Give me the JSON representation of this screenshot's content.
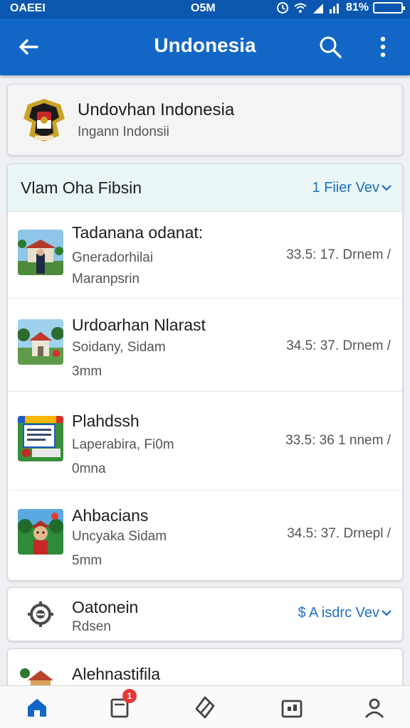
{
  "status_bar": {
    "left": "OAEEI",
    "center": "O5M",
    "battery": "81%"
  },
  "app_bar": {
    "title": "Undonesia"
  },
  "profile": {
    "title": "Undovhan Indonesia",
    "subtitle": "Ingann Indonsii"
  },
  "list": {
    "header_title": "Vlam Oha Fibsin",
    "header_link": "1 Fiier Vev",
    "items": [
      {
        "title": "Tadanana odanat:",
        "subtitle": "Gneradorhilai",
        "subtitle2": "Maranpsrin",
        "meta": "33.5: 17. Drnem /",
        "icon": "landmark-photo-icon"
      },
      {
        "title": "Urdoarhan Nlarast",
        "subtitle": "Soidany, Sidam",
        "subtitle2": "3mm",
        "meta": "34.5: 37. Drnem /",
        "icon": "monument-photo-icon"
      },
      {
        "title": "Plahdssh",
        "subtitle": "Laperabira, Fi0m",
        "subtitle2": "0mna",
        "meta": "33.5: 36 1 nnem /",
        "icon": "document-illustration-icon"
      },
      {
        "title": "Ahbacians",
        "subtitle": "Uncyaka Sidam",
        "subtitle2": "5mm",
        "meta": "34.5: 37. Drnepl /",
        "icon": "character-illustration-icon"
      }
    ]
  },
  "location": {
    "title": "Oatonein",
    "subtitle": "Rdsen",
    "link": "$ A isdrc Vev"
  },
  "partial_item": {
    "title": "Alehnastifila"
  },
  "bottom_nav": {
    "badge": "1"
  },
  "colors": {
    "primary": "#1267c6",
    "status_bar": "#0b57b0",
    "link": "#1e6fbe",
    "header_tint": "#e9f6f5",
    "badge": "#e53935"
  }
}
